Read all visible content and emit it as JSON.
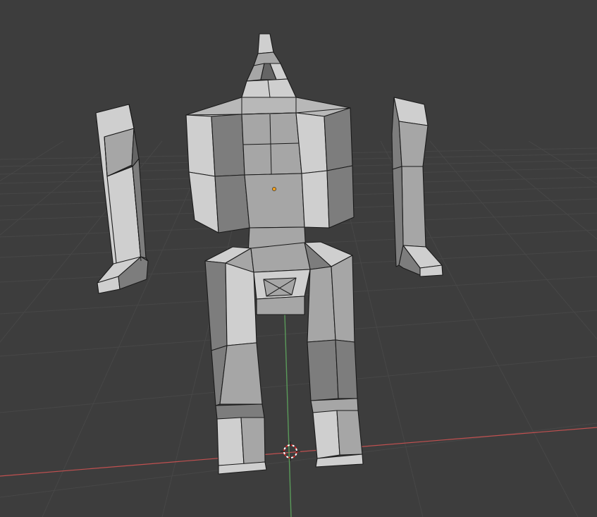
{
  "viewport": {
    "mode": "3d-viewport",
    "background_color": "#3d3d3d",
    "grid_color": "#474747",
    "axis_x_color": "#c05050",
    "axis_y_color": "#5a9a5a",
    "origin_color": "#f0a020",
    "cursor_colors": [
      "#cc2222",
      "#ffffff"
    ]
  },
  "scene": {
    "objects": [
      "robot-body",
      "left-arm",
      "right-arm",
      "left-leg",
      "right-leg",
      "head-antenna"
    ],
    "icons": [
      "object-origin-icon",
      "3d-cursor-icon"
    ]
  }
}
